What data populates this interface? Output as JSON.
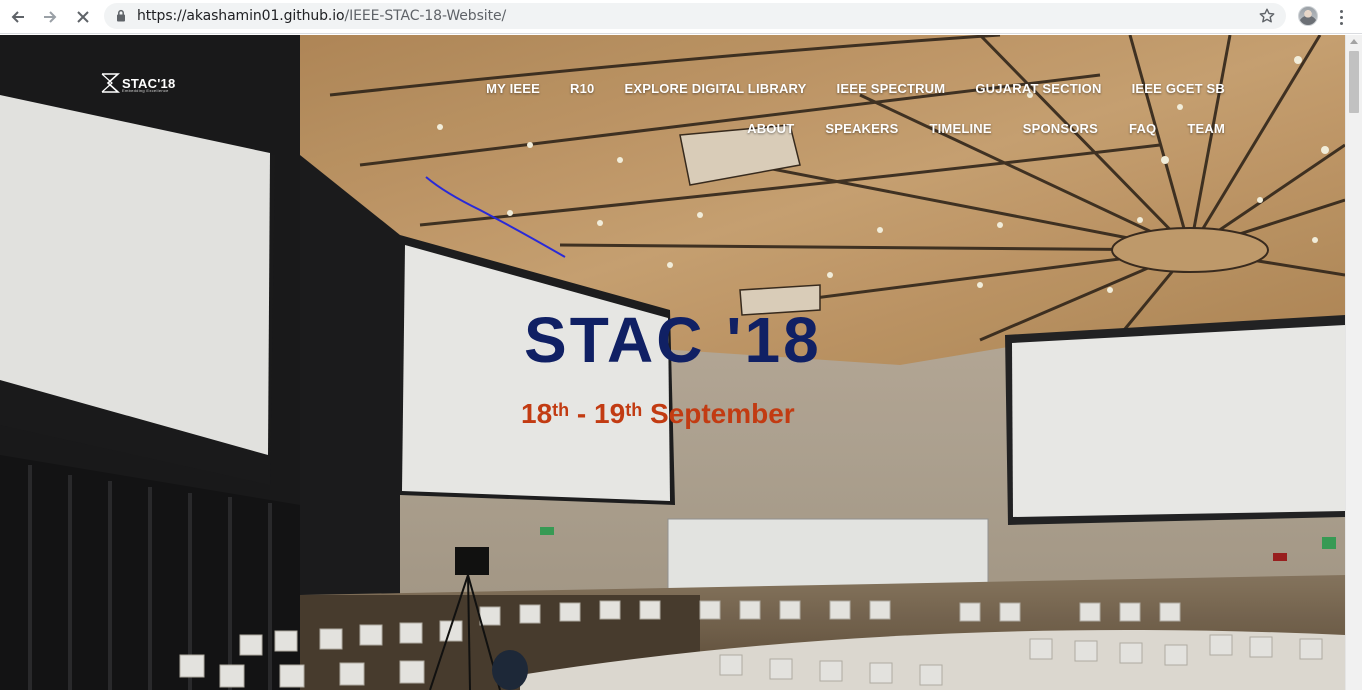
{
  "browser": {
    "url_host": "https://akashamin01.github.io",
    "url_path": "/IEEE-STAC-18-Website/",
    "icons": {
      "back": "back-arrow-icon",
      "forward": "forward-arrow-icon",
      "stop": "stop-loading-icon",
      "lock": "lock-icon",
      "bookmark": "star-icon",
      "menu": "kebab-menu-icon"
    }
  },
  "site": {
    "logo": {
      "text": "STAC'18",
      "tagline": "Embedding Excellence"
    },
    "nav_primary": [
      "MY IEEE",
      "R10",
      "EXPLORE DIGITAL LIBRARY",
      "IEEE SPECTRUM",
      "GUJARAT SECTION",
      "IEEE GCET SB"
    ],
    "nav_secondary": [
      "ABOUT",
      "SPEAKERS",
      "TIMELINE",
      "SPONSORS",
      "FAQ",
      "TEAM"
    ],
    "hero": {
      "title": "STAC '18",
      "date_day1": "18",
      "date_day1_suffix": "th",
      "date_sep": " - ",
      "date_day2": "19",
      "date_day2_suffix": "th",
      "date_month": " September"
    }
  },
  "colors": {
    "hero_title": "#102064",
    "hero_date": "#c23b12",
    "nav_text": "#ffffff"
  }
}
